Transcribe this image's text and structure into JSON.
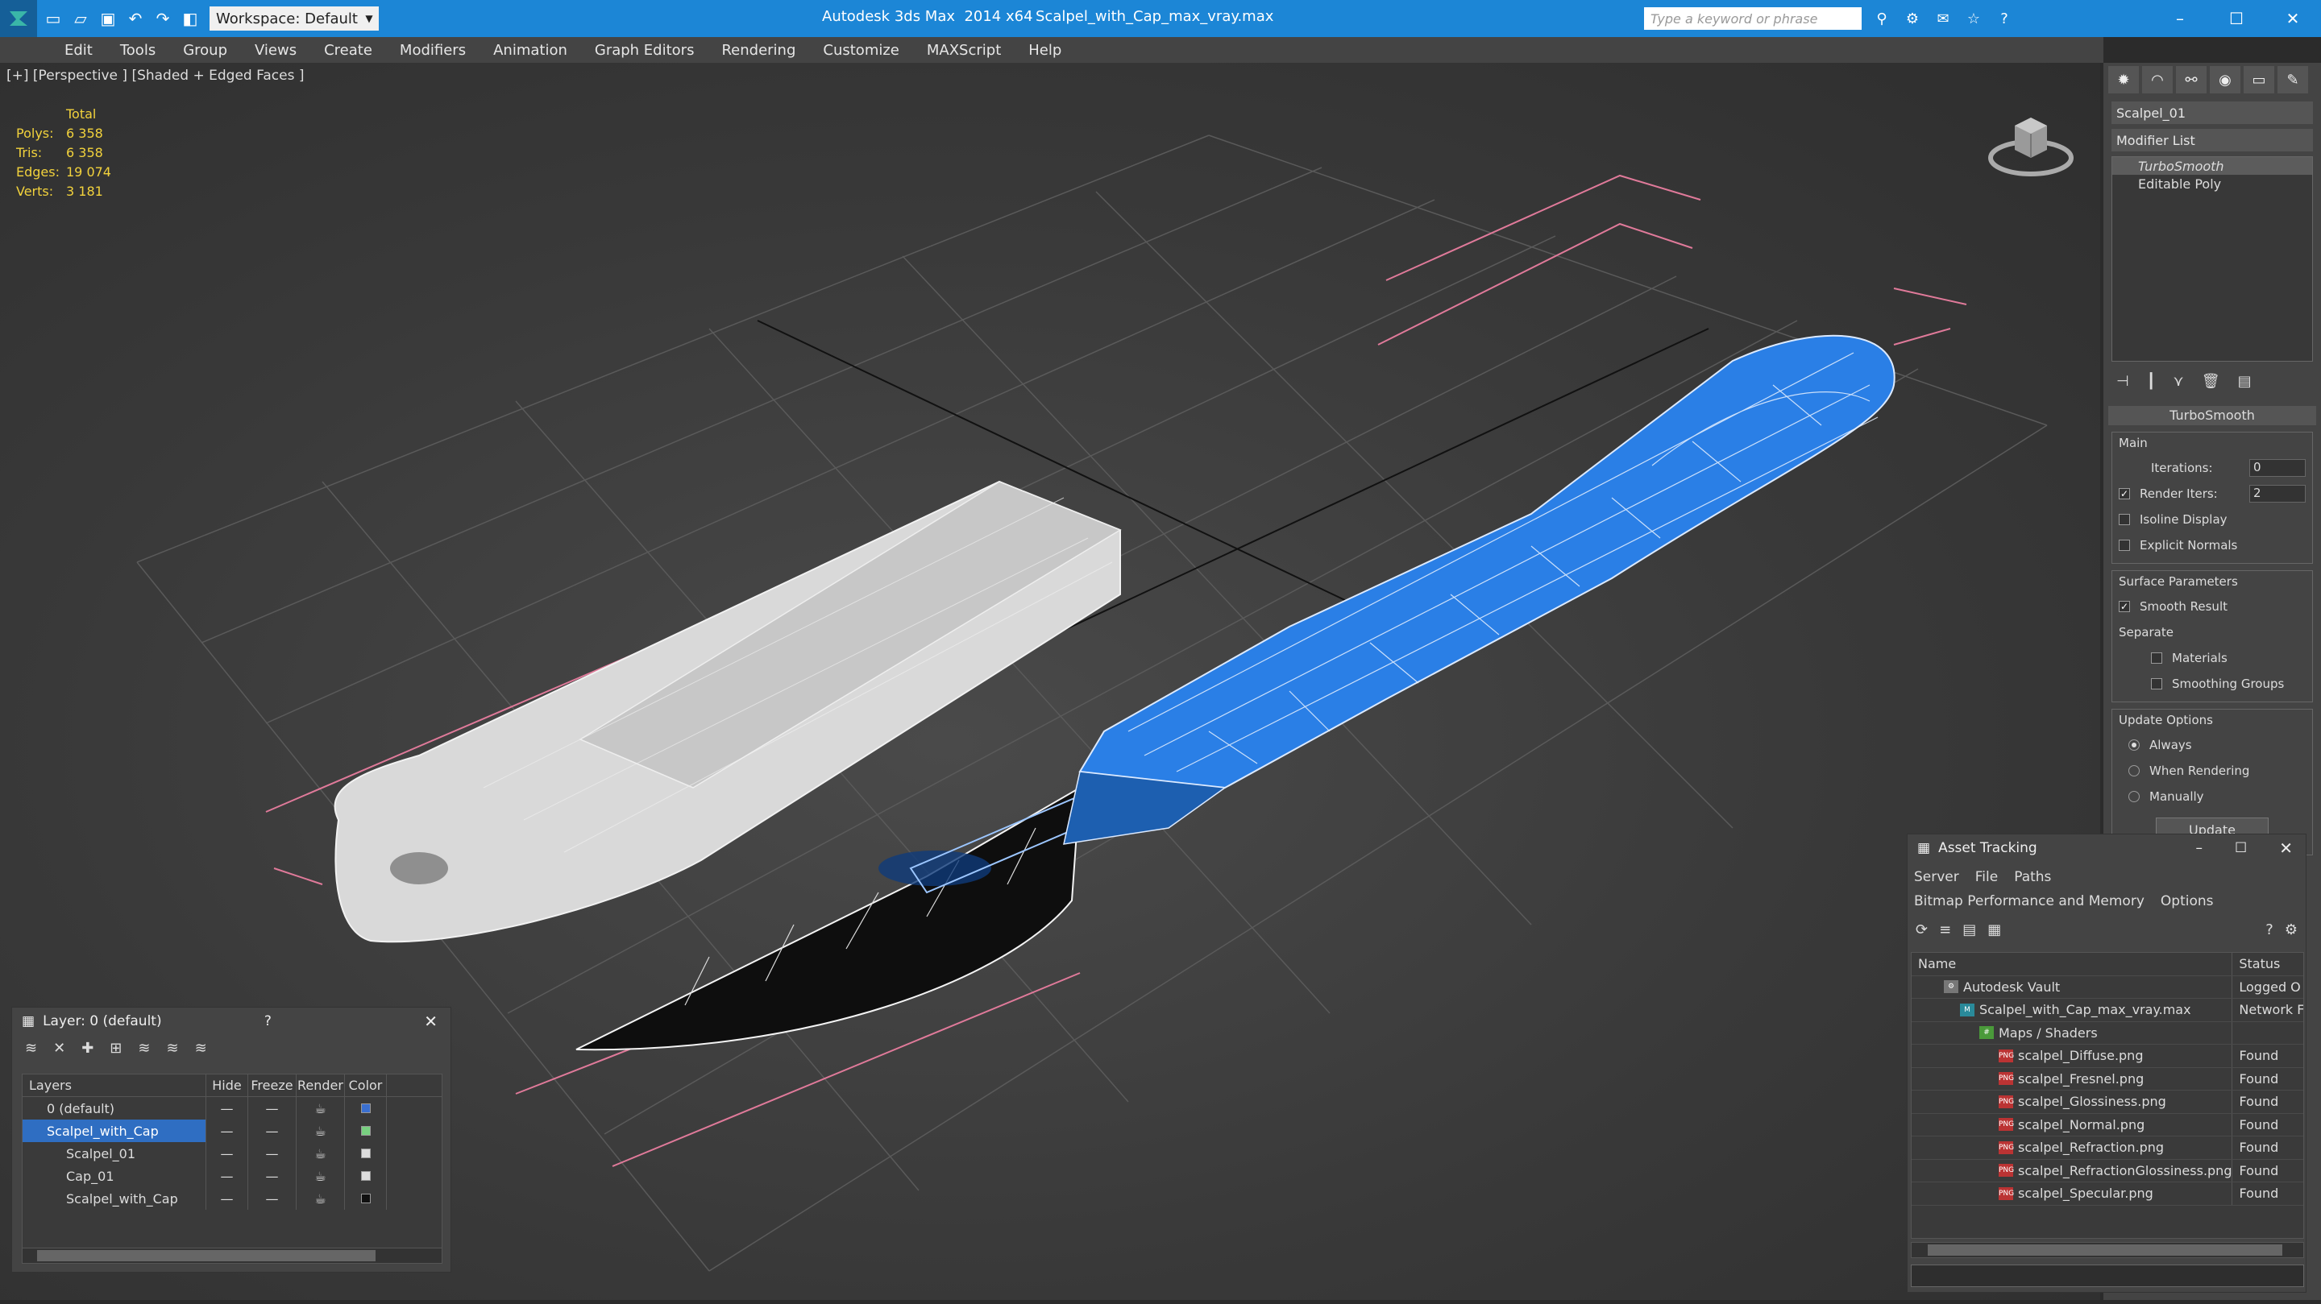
{
  "titlebar": {
    "app_title": "Autodesk 3ds Max  2014 x64",
    "file_name": "Scalpel_with_Cap_max_vray.max",
    "workspace": "Workspace: Default",
    "search_placeholder": "Type a keyword or phrase"
  },
  "menu": [
    "Edit",
    "Tools",
    "Group",
    "Views",
    "Create",
    "Modifiers",
    "Animation",
    "Graph Editors",
    "Rendering",
    "Customize",
    "MAXScript",
    "Help"
  ],
  "viewport": {
    "label": "[+] [Perspective ] [Shaded + Edged Faces ]",
    "stats": {
      "total_label": "Total",
      "rows": [
        {
          "k": "Polys:",
          "v": "6 358"
        },
        {
          "k": "Tris:",
          "v": "6 358"
        },
        {
          "k": "Edges:",
          "v": "19 074"
        },
        {
          "k": "Verts:",
          "v": "3 181"
        }
      ]
    }
  },
  "command_panel": {
    "object_name": "Scalpel_01",
    "modifier_list": "Modifier List",
    "stack": [
      "TurboSmooth",
      "Editable Poly"
    ],
    "rollout": "TurboSmooth",
    "main_group": "Main",
    "iterations_label": "Iterations:",
    "iterations_value": "0",
    "render_iters_label": "Render Iters:",
    "render_iters_value": "2",
    "isoline": "Isoline Display",
    "explicit_normals": "Explicit Normals",
    "surface_group": "Surface Parameters",
    "smooth_result": "Smooth Result",
    "separate": "Separate",
    "materials": "Materials",
    "smoothing_groups": "Smoothing Groups",
    "update_group": "Update Options",
    "always": "Always",
    "when_rendering": "When Rendering",
    "manually": "Manually",
    "update_btn": "Update"
  },
  "layer_dialog": {
    "title": "Layer: 0 (default)",
    "help": "?",
    "columns": [
      "Layers",
      "Hide",
      "Freeze",
      "Render",
      "Color"
    ],
    "rows": [
      {
        "name": "0 (default)",
        "color": "#3a6fd0"
      },
      {
        "name": "Scalpel_with_Cap",
        "color": "#78d080"
      },
      {
        "name": "Scalpel_01",
        "color": "#dddddd"
      },
      {
        "name": "Cap_01",
        "color": "#dddddd"
      },
      {
        "name": "Scalpel_with_Cap",
        "color": "#111111"
      }
    ]
  },
  "asset_dialog": {
    "title": "Asset Tracking",
    "menu": [
      "Server",
      "File",
      "Paths",
      "Bitmap Performance and Memory",
      "Options"
    ],
    "columns": [
      "Name",
      "Status"
    ],
    "rows": [
      {
        "name": "Autodesk Vault",
        "status": "Logged O"
      },
      {
        "name": "Scalpel_with_Cap_max_vray.max",
        "status": "Network F"
      },
      {
        "name": "Maps / Shaders",
        "status": ""
      },
      {
        "name": "scalpel_Diffuse.png",
        "status": "Found"
      },
      {
        "name": "scalpel_Fresnel.png",
        "status": "Found"
      },
      {
        "name": "scalpel_Glossiness.png",
        "status": "Found"
      },
      {
        "name": "scalpel_Normal.png",
        "status": "Found"
      },
      {
        "name": "scalpel_Refraction.png",
        "status": "Found"
      },
      {
        "name": "scalpel_RefractionGlossiness.png",
        "status": "Found"
      },
      {
        "name": "scalpel_Specular.png",
        "status": "Found"
      }
    ]
  }
}
